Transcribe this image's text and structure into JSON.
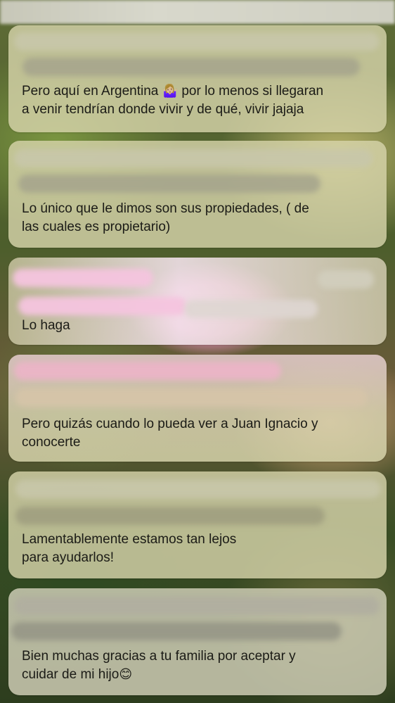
{
  "messages": [
    {
      "text_before": "Pero aquí en Argentina",
      "emoji": "🤷🏼‍♀️",
      "text_after": " por lo menos si llegaran\na venir tendrían donde vivir y de qué, vivir jajaja"
    },
    {
      "text": "Lo único que le dimos son sus propiedades, ( de\nlas cuales es propietario)"
    },
    {
      "text": "Lo haga"
    },
    {
      "text": "Pero quizás cuando lo pueda ver a Juan Ignacio y\nconocerte"
    },
    {
      "text": "Lamentablemente estamos tan lejos\npara ayudarlos!"
    },
    {
      "text": "Bien muchas gracias a tu familia por aceptar y\ncuidar de mi hijo",
      "emoji": "😊"
    }
  ],
  "icons": {
    "shrug": "woman-shrugging-icon",
    "smile": "smiling-face-icon"
  }
}
